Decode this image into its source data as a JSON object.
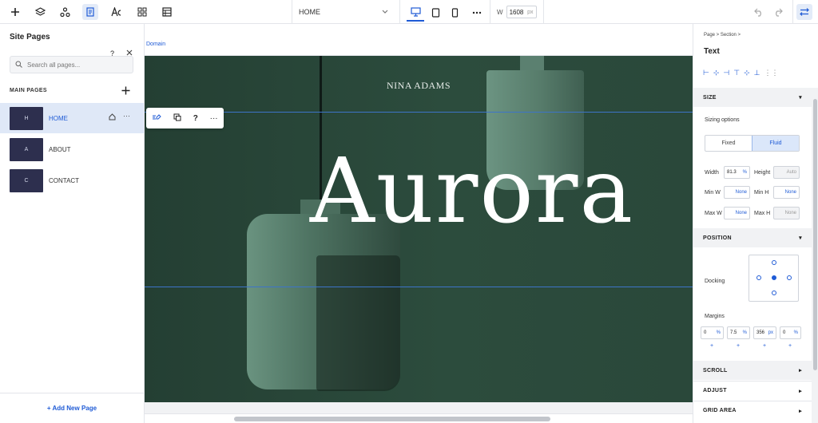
{
  "toolbar": {
    "page_select": "HOME",
    "width_label": "W",
    "width_value": "1608",
    "width_unit": "px"
  },
  "left_panel": {
    "title": "Site Pages",
    "search_placeholder": "Search all pages...",
    "section": "MAIN PAGES",
    "pages": [
      {
        "thumb": "H",
        "label": "HOME"
      },
      {
        "thumb": "A",
        "label": "ABOUT"
      },
      {
        "thumb": "C",
        "label": "CONTACT"
      }
    ],
    "add_new": "+ Add New Page"
  },
  "canvas": {
    "domain": "Domain",
    "brand": "NINA ADAMS",
    "headline": "Aurora"
  },
  "right_panel": {
    "breadcrumb": "Page  >  Section  >",
    "title": "Text",
    "size": {
      "header": "SIZE",
      "sizing_label": "Sizing options",
      "fixed": "Fixed",
      "fluid": "Fluid",
      "width_label": "Width",
      "width_value": "81.3",
      "width_unit": "%",
      "height_label": "Height",
      "height_value": "Auto",
      "minw_label": "Min W",
      "minw_value": "None",
      "minh_label": "Min H",
      "minh_value": "None",
      "maxw_label": "Max W",
      "maxw_value": "None",
      "maxh_label": "Max H",
      "maxh_value": "None"
    },
    "position": {
      "header": "POSITION",
      "docking_label": "Docking",
      "margins_label": "Margins",
      "margins": [
        {
          "value": "0",
          "unit": "%"
        },
        {
          "value": "7.5",
          "unit": "%"
        },
        {
          "value": "356",
          "unit": "px"
        },
        {
          "value": "0",
          "unit": "%"
        }
      ]
    },
    "sections": [
      "SCROLL",
      "ADJUST",
      "GRID AREA"
    ]
  },
  "colors": {
    "accent": "#1f5bd6",
    "hero_bg": "#2c4c3d",
    "page_thumb": "#2d2f4e"
  }
}
